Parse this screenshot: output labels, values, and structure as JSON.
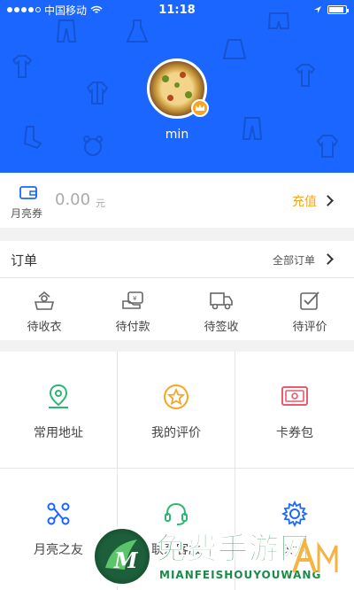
{
  "status_bar": {
    "carrier": "中国移动",
    "time": "11:18"
  },
  "profile": {
    "username": "min"
  },
  "balance": {
    "label": "月亮券",
    "amount": "0.00",
    "unit": "元",
    "recharge_label": "充值"
  },
  "orders": {
    "title": "订单",
    "all_label": "全部订单",
    "items": [
      {
        "label": "待收衣",
        "icon": "shirt-box-icon"
      },
      {
        "label": "待付款",
        "icon": "payment-icon"
      },
      {
        "label": "待签收",
        "icon": "truck-icon"
      },
      {
        "label": "待评价",
        "icon": "checkbox-edit-icon"
      }
    ]
  },
  "services": [
    {
      "label": "常用地址",
      "icon": "location-pin-icon",
      "color": "#2bb673"
    },
    {
      "label": "我的评价",
      "icon": "star-icon",
      "color": "#f5a623"
    },
    {
      "label": "卡券包",
      "icon": "coupon-icon",
      "color": "#e85c6d"
    },
    {
      "label": "月亮之友",
      "icon": "network-icon",
      "color": "#1a66ff"
    },
    {
      "label": "联系客服",
      "icon": "headset-icon",
      "color": "#2bb673"
    },
    {
      "label": "设置",
      "icon": "gear-icon",
      "color": "#1a66ff"
    }
  ],
  "watermark": {
    "title": "免费手游网",
    "subtitle": "MIANFEISHOUYOUWANG"
  },
  "colors": {
    "brand_blue": "#1a66ff",
    "accent_orange": "#f5a623"
  }
}
